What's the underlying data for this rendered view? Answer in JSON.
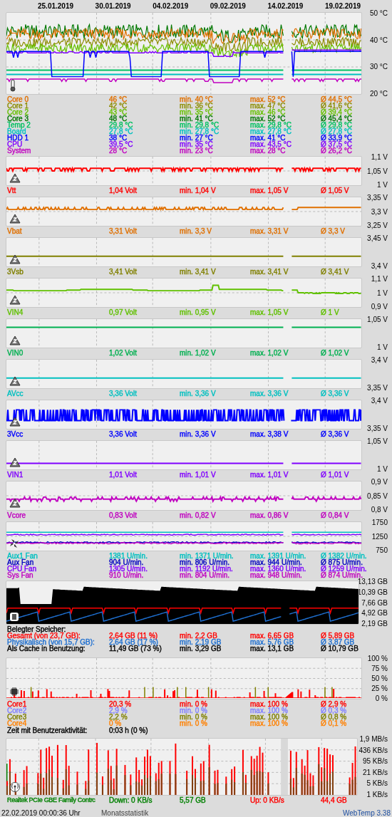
{
  "dates": [
    "25.01.2019",
    "30.01.2019",
    "04.02.2019",
    "09.02.2019",
    "14.02.2019",
    "19.02.2019"
  ],
  "panels": [
    {
      "kind": "temp",
      "axis": [
        "50 °C",
        "40 °C",
        "30 °C",
        "20 °C"
      ],
      "rows": [
        {
          "label": "Core 0",
          "current": "46 °C",
          "min": "min. 40 °C",
          "max": "max. 52 °C",
          "avg": "Ø 44,5 °C",
          "color": "#e07000"
        },
        {
          "label": "Core 1",
          "current": "42 °C",
          "min": "min. 36 °C",
          "max": "max. 47 °C",
          "avg": "Ø 41,6 °C",
          "color": "#8c8c00"
        },
        {
          "label": "Core 2",
          "current": "43 °C",
          "min": "min. 35 °C",
          "max": "max. 46 °C",
          "avg": "Ø 39,4 °C",
          "color": "#66c000"
        },
        {
          "label": "Core 3",
          "current": "48 °C",
          "min": "min. 41 °C",
          "max": "max. 52 °C",
          "avg": "Ø 45,4 °C",
          "color": "#007800"
        },
        {
          "label": "Temp 2",
          "current": "29,8 °C",
          "min": "min. 29,8 °C",
          "max": "max. 29,8 °C",
          "avg": "Ø 29,8 °C",
          "color": "#00c060"
        },
        {
          "label": "Board",
          "current": "27,8 °C",
          "min": "min. 27,8 °C",
          "max": "max. 27,8 °C",
          "avg": "Ø 27,8 °C",
          "color": "#00c0c0"
        },
        {
          "label": "HDD 1",
          "current": "38 °C",
          "min": "min. 27 °C",
          "max": "max. 41 °C",
          "avg": "Ø 33,9 °C",
          "color": "#0000ff"
        },
        {
          "label": "CPU",
          "current": "39,5 °C",
          "min": "min. 35 °C",
          "max": "max. 43,5 °C",
          "avg": "Ø 37,5 °C",
          "color": "#8000ff"
        },
        {
          "label": "System",
          "current": "28 °C",
          "min": "min. 23 °C",
          "max": "max. 28 °C",
          "avg": "Ø 26,2 °C",
          "color": "#c000c0"
        }
      ]
    },
    {
      "kind": "volt",
      "axis": [
        "1,1 V",
        "1,05 V",
        "1 V"
      ],
      "rows": [
        {
          "label": "Vtt",
          "current": "1,04 Volt",
          "min": "min. 1,04 V",
          "max": "max. 1,05 V",
          "avg": "Ø 1,05 V",
          "color": "#ff0000"
        }
      ]
    },
    {
      "kind": "volt",
      "axis": [
        "3,35 V",
        "3,3 V",
        "3,25 V"
      ],
      "rows": [
        {
          "label": "Vbat",
          "current": "3,31 Volt",
          "min": "min. 3,3 V",
          "max": "max. 3,31 V",
          "avg": "Ø 3,3 V",
          "color": "#e07000"
        }
      ]
    },
    {
      "kind": "volt",
      "axis": [
        "3,45 V",
        "3,4 V"
      ],
      "rows": [
        {
          "label": "3Vsb",
          "current": "3,41 Volt",
          "min": "min. 3,41 V",
          "max": "max. 3,41 V",
          "avg": "Ø 3,41 V",
          "color": "#808000"
        }
      ]
    },
    {
      "kind": "volt",
      "axis": [
        "1,1 V",
        "1 V",
        "0,9 V"
      ],
      "rows": [
        {
          "label": "VIN4",
          "current": "0,97 Volt",
          "min": "min. 0,95 V",
          "max": "max. 1,05 V",
          "avg": "Ø 1 V",
          "color": "#60c000"
        }
      ]
    },
    {
      "kind": "volt",
      "axis": [
        "1,05 V",
        "1 V"
      ],
      "rows": [
        {
          "label": "VIN0",
          "current": "1,02 Volt",
          "min": "min. 1,02 V",
          "max": "max. 1,02 V",
          "avg": "Ø 1,02 V",
          "color": "#00b050"
        }
      ]
    },
    {
      "kind": "volt",
      "axis": [
        "3,4 V",
        "3,35 V"
      ],
      "rows": [
        {
          "label": "AVcc",
          "current": "3,36 Volt",
          "min": "min. 3,36 V",
          "max": "max. 3,36 V",
          "avg": "Ø 3,36 V",
          "color": "#00c0c0"
        }
      ]
    },
    {
      "kind": "volt",
      "axis": [
        "3,4 V",
        "3,35 V"
      ],
      "rows": [
        {
          "label": "3Vcc",
          "current": "3,36 Volt",
          "min": "min. 3,36 V",
          "max": "max. 3,38 V",
          "avg": "Ø 3,36 V",
          "color": "#0000ff"
        }
      ]
    },
    {
      "kind": "volt",
      "axis": [
        "1,05 V",
        "1 V"
      ],
      "rows": [
        {
          "label": "VIN1",
          "current": "1,01 Volt",
          "min": "min. 1,01 V",
          "max": "max. 1,01 V",
          "avg": "Ø 1,01 V",
          "color": "#8000ff"
        }
      ]
    },
    {
      "kind": "volt",
      "axis": [
        "0,9 V",
        "0,85 V",
        "0,8 V"
      ],
      "rows": [
        {
          "label": "Vcore",
          "current": "0,83 Volt",
          "min": "min. 0,82 V",
          "max": "max. 0,86 V",
          "avg": "Ø 0,84 V",
          "color": "#c000c0"
        }
      ]
    },
    {
      "kind": "fan",
      "axis": [
        "1750",
        "1250",
        "750"
      ],
      "rows": [
        {
          "label": "Aux1 Fan",
          "current": "1381 U/min.",
          "min": "min. 1371 U/min.",
          "max": "max. 1391 U/min.",
          "avg": "Ø 1382 U/min.",
          "color": "#00c0c0"
        },
        {
          "label": "Aux Fan",
          "current": "904 U/min.",
          "min": "min. 806 U/min.",
          "max": "max. 944 U/min.",
          "avg": "Ø 875 U/min.",
          "color": "#0000c0"
        },
        {
          "label": "CPU Fan",
          "current": "1305 U/min.",
          "min": "min. 1192 U/min.",
          "max": "max. 1360 U/min.",
          "avg": "Ø 1259 U/min.",
          "color": "#8000ff"
        },
        {
          "label": "Sys Fan",
          "current": "910 U/min.",
          "min": "min. 804 U/min.",
          "max": "max. 948 U/min.",
          "avg": "Ø 874 U/min.",
          "color": "#c000c0"
        }
      ]
    },
    {
      "kind": "memory",
      "axis": [
        "13,13 GB",
        "10,39 GB",
        "7,66 GB",
        "4,92 GB",
        "2,19 GB"
      ],
      "heading": "Belegter Speicher:",
      "rows": [
        {
          "label": "Gesamt (von 23,7 GB):",
          "current": "2,64 GB (11 %)",
          "min": "min. 2,2 GB",
          "max": "max. 6,65 GB",
          "avg": "Ø 5,89 GB",
          "color": "#ff0000"
        },
        {
          "label": "Physikalisch (von 15,7 GB):",
          "current": "2,64 GB (17 %)",
          "min": "min. 2,19 GB",
          "max": "max. 5,76 GB",
          "avg": "Ø 3,87 GB",
          "color": "#1e6fd0"
        },
        {
          "label": "Als Cache in Benutzung:",
          "current": "11,49 GB (73 %)",
          "min": "min. 3,29 GB",
          "max": "max. 13,1 GB",
          "avg": "Ø 10,79 GB",
          "color": "#000000"
        }
      ]
    },
    {
      "kind": "cpu",
      "axis": [
        "100 %",
        "75 %",
        "50 %",
        "25 %",
        "0 %"
      ],
      "rows": [
        {
          "label": "Core1",
          "current": "20,3 %",
          "min": "min. 0 %",
          "max": "max. 100 %",
          "avg": "Ø 2,9 %",
          "color": "#ff0000"
        },
        {
          "label": "Core2",
          "current": "2,9 %",
          "min": "min. 0 %",
          "max": "max. 100 %",
          "avg": "Ø 0,3 %",
          "color": "#8080ff"
        },
        {
          "label": "Core3",
          "current": "2,2 %",
          "min": "min. 0 %",
          "max": "max. 100 %",
          "avg": "Ø 0,8 %",
          "color": "#808000"
        },
        {
          "label": "Core4",
          "current": "0 %",
          "min": "min. 0 %",
          "max": "max. 100 %",
          "avg": "Ø 0,1 %",
          "color": "#ff8000"
        }
      ],
      "note": {
        "label": "Zeit mit Benutzeraktivität:",
        "value": "0:03 h (0 %)"
      }
    },
    {
      "kind": "net",
      "axis": [
        "1,9 MB/s",
        "436 KB/s",
        "95 KB/s",
        "21 KB/s",
        "5 KB/s",
        "1 KB/s"
      ],
      "adapter": "Realtek PCIe GBE Family Contrc",
      "down": {
        "rate": "Down: 0 KB/s",
        "total": "5,57 GB",
        "color": "#008000"
      },
      "up": {
        "rate": "Up: 0 KB/s",
        "total": "44,4 GB",
        "color": "#ff0000"
      }
    }
  ],
  "footer": {
    "timestamp": "22.02.2019 00:00:36 Uhr",
    "view": "Monatsstatistik",
    "version": "WebTemp 3.38"
  }
}
